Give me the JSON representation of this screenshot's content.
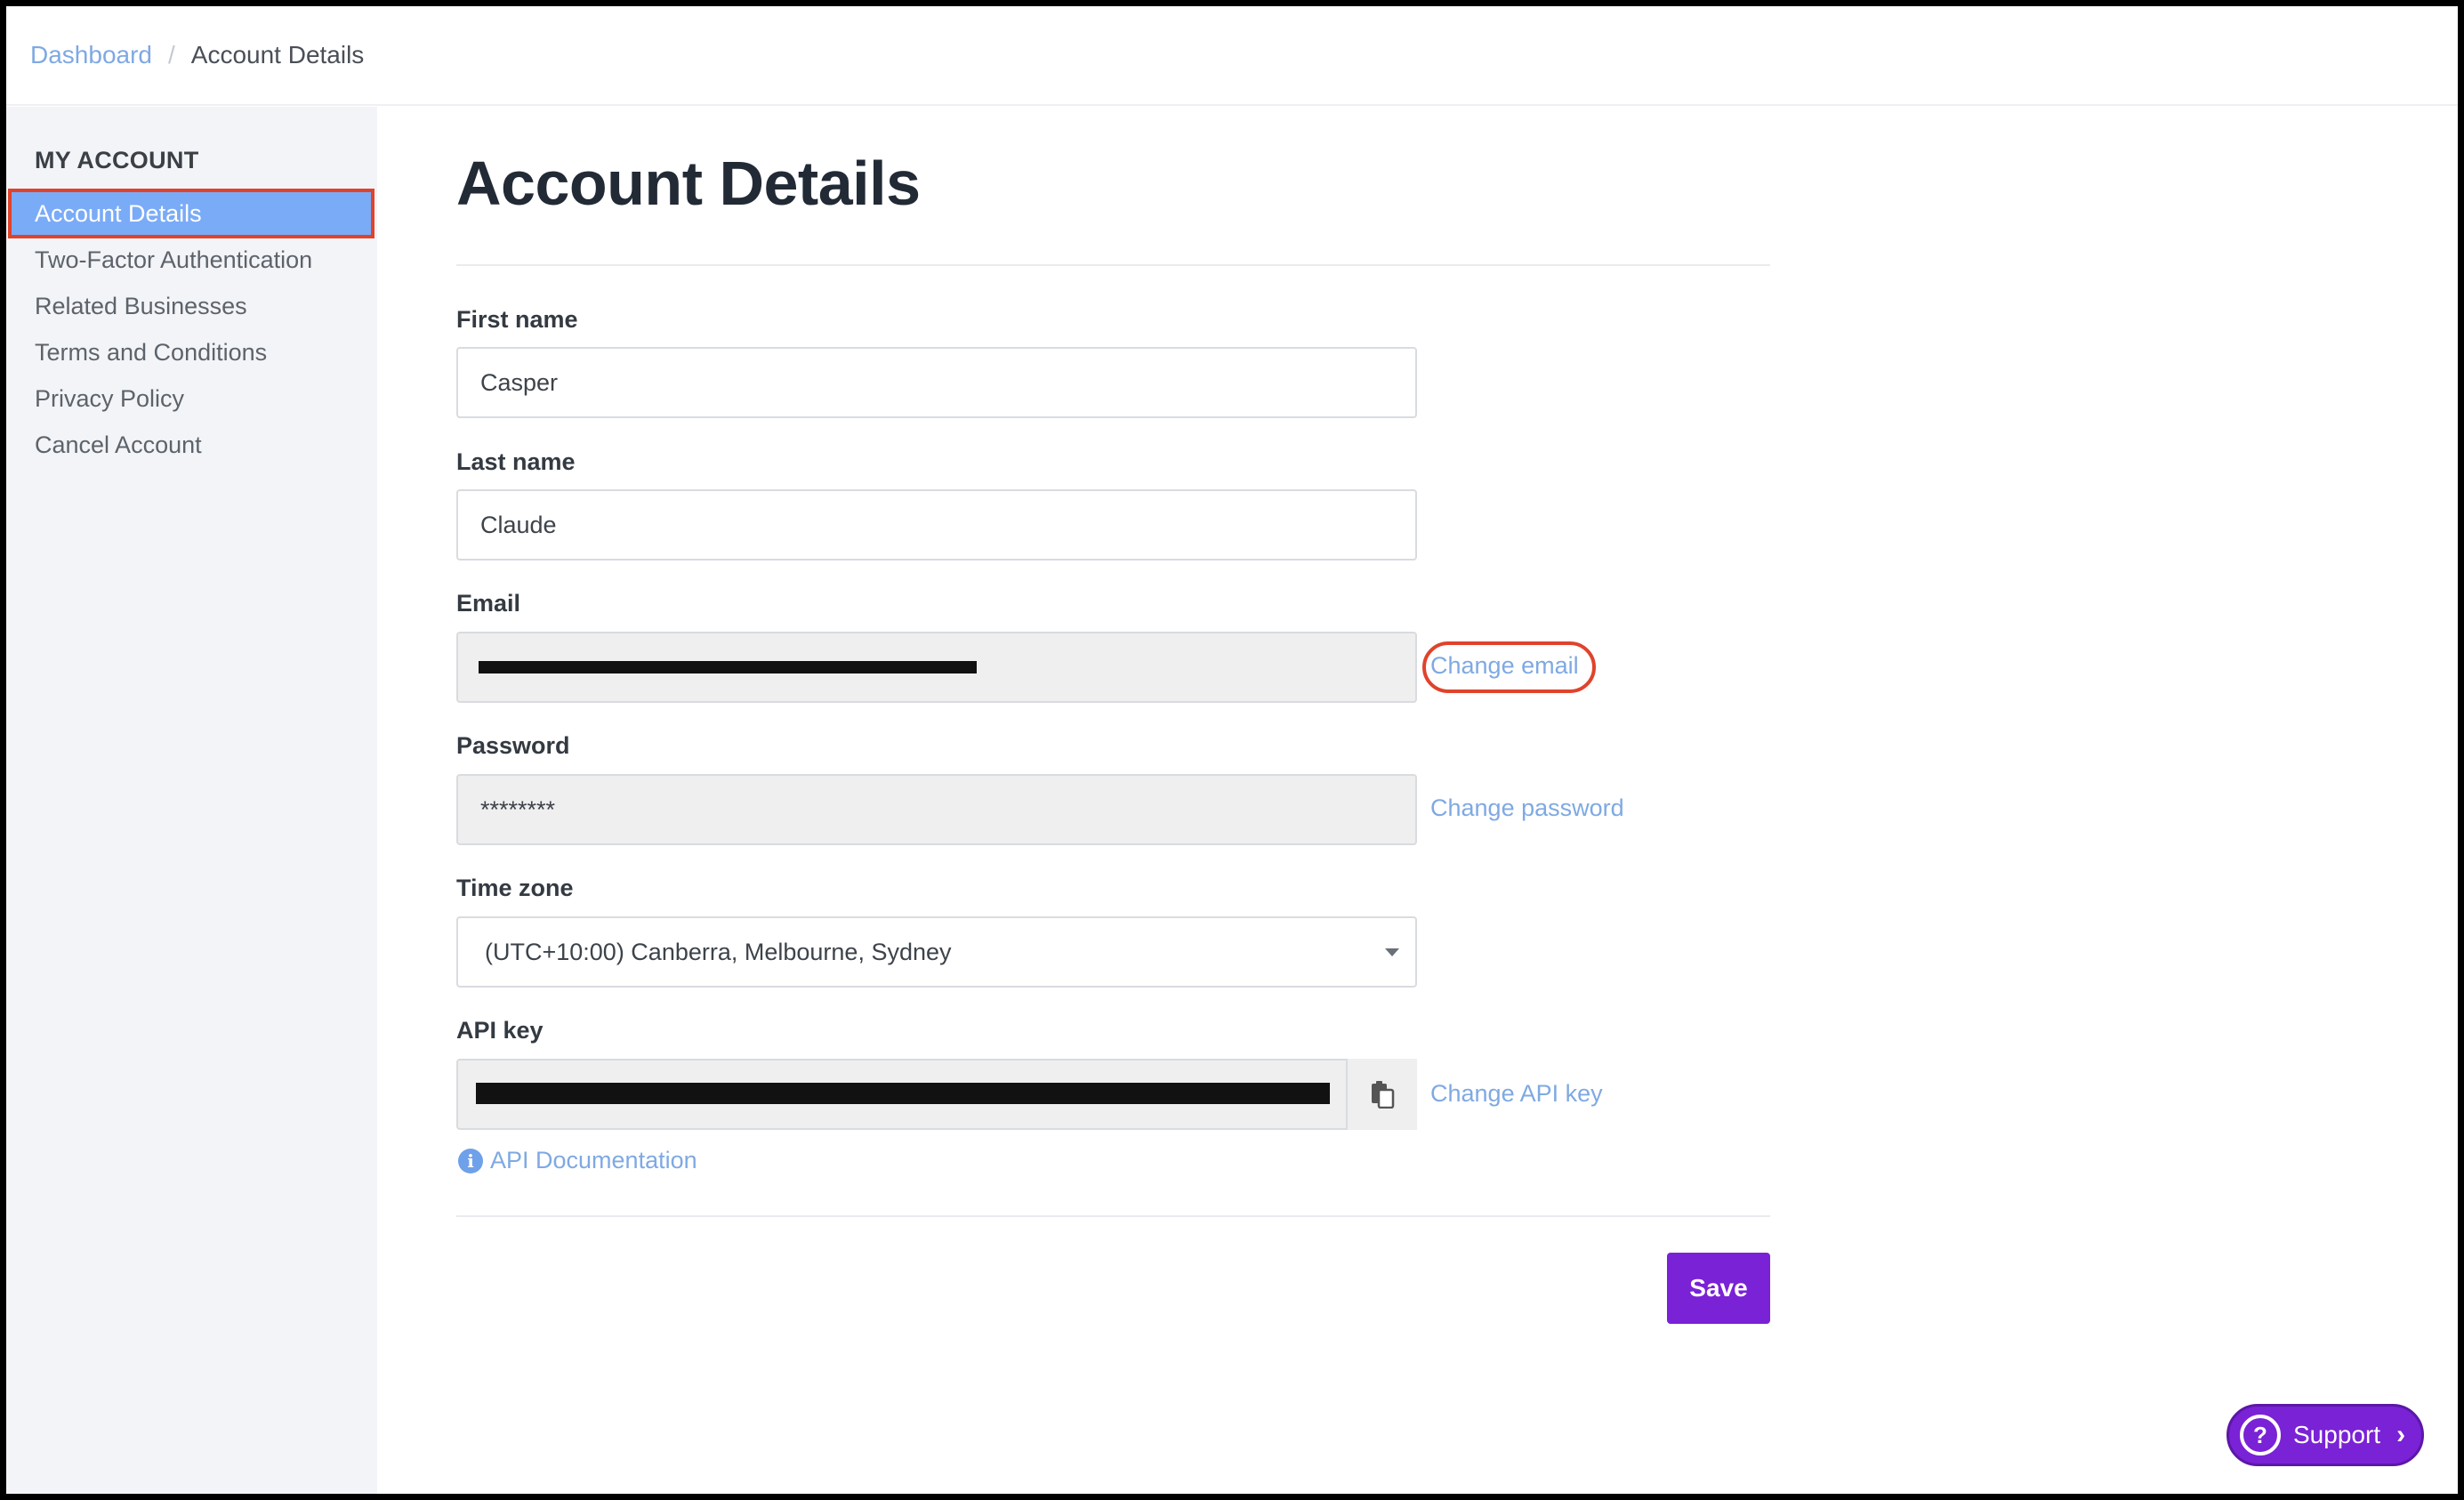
{
  "breadcrumb": {
    "root": "Dashboard",
    "separator": "/",
    "current": "Account Details"
  },
  "sidebar": {
    "heading": "MY ACCOUNT",
    "items": [
      {
        "label": "Account Details",
        "active": true
      },
      {
        "label": "Two-Factor Authentication"
      },
      {
        "label": "Related Businesses"
      },
      {
        "label": "Terms and Conditions"
      },
      {
        "label": "Privacy Policy"
      },
      {
        "label": "Cancel Account"
      }
    ]
  },
  "main": {
    "title": "Account Details",
    "fields": {
      "first_name": {
        "label": "First name",
        "value": "Casper"
      },
      "last_name": {
        "label": "Last name",
        "value": "Claude"
      },
      "email": {
        "label": "Email",
        "value": "",
        "action": "Change email"
      },
      "password": {
        "label": "Password",
        "value": "********",
        "action": "Change password"
      },
      "time_zone": {
        "label": "Time zone",
        "value": "(UTC+10:00) Canberra, Melbourne, Sydney"
      },
      "api_key": {
        "label": "API key",
        "value": "",
        "action": "Change API key",
        "docs": "API Documentation"
      }
    },
    "save_label": "Save"
  },
  "support": {
    "label": "Support",
    "icon": "?"
  },
  "colors": {
    "accent": "#7a22d6",
    "link": "#7fa9e3",
    "active_item": "#7aabf7",
    "annotation": "#e0432c"
  }
}
